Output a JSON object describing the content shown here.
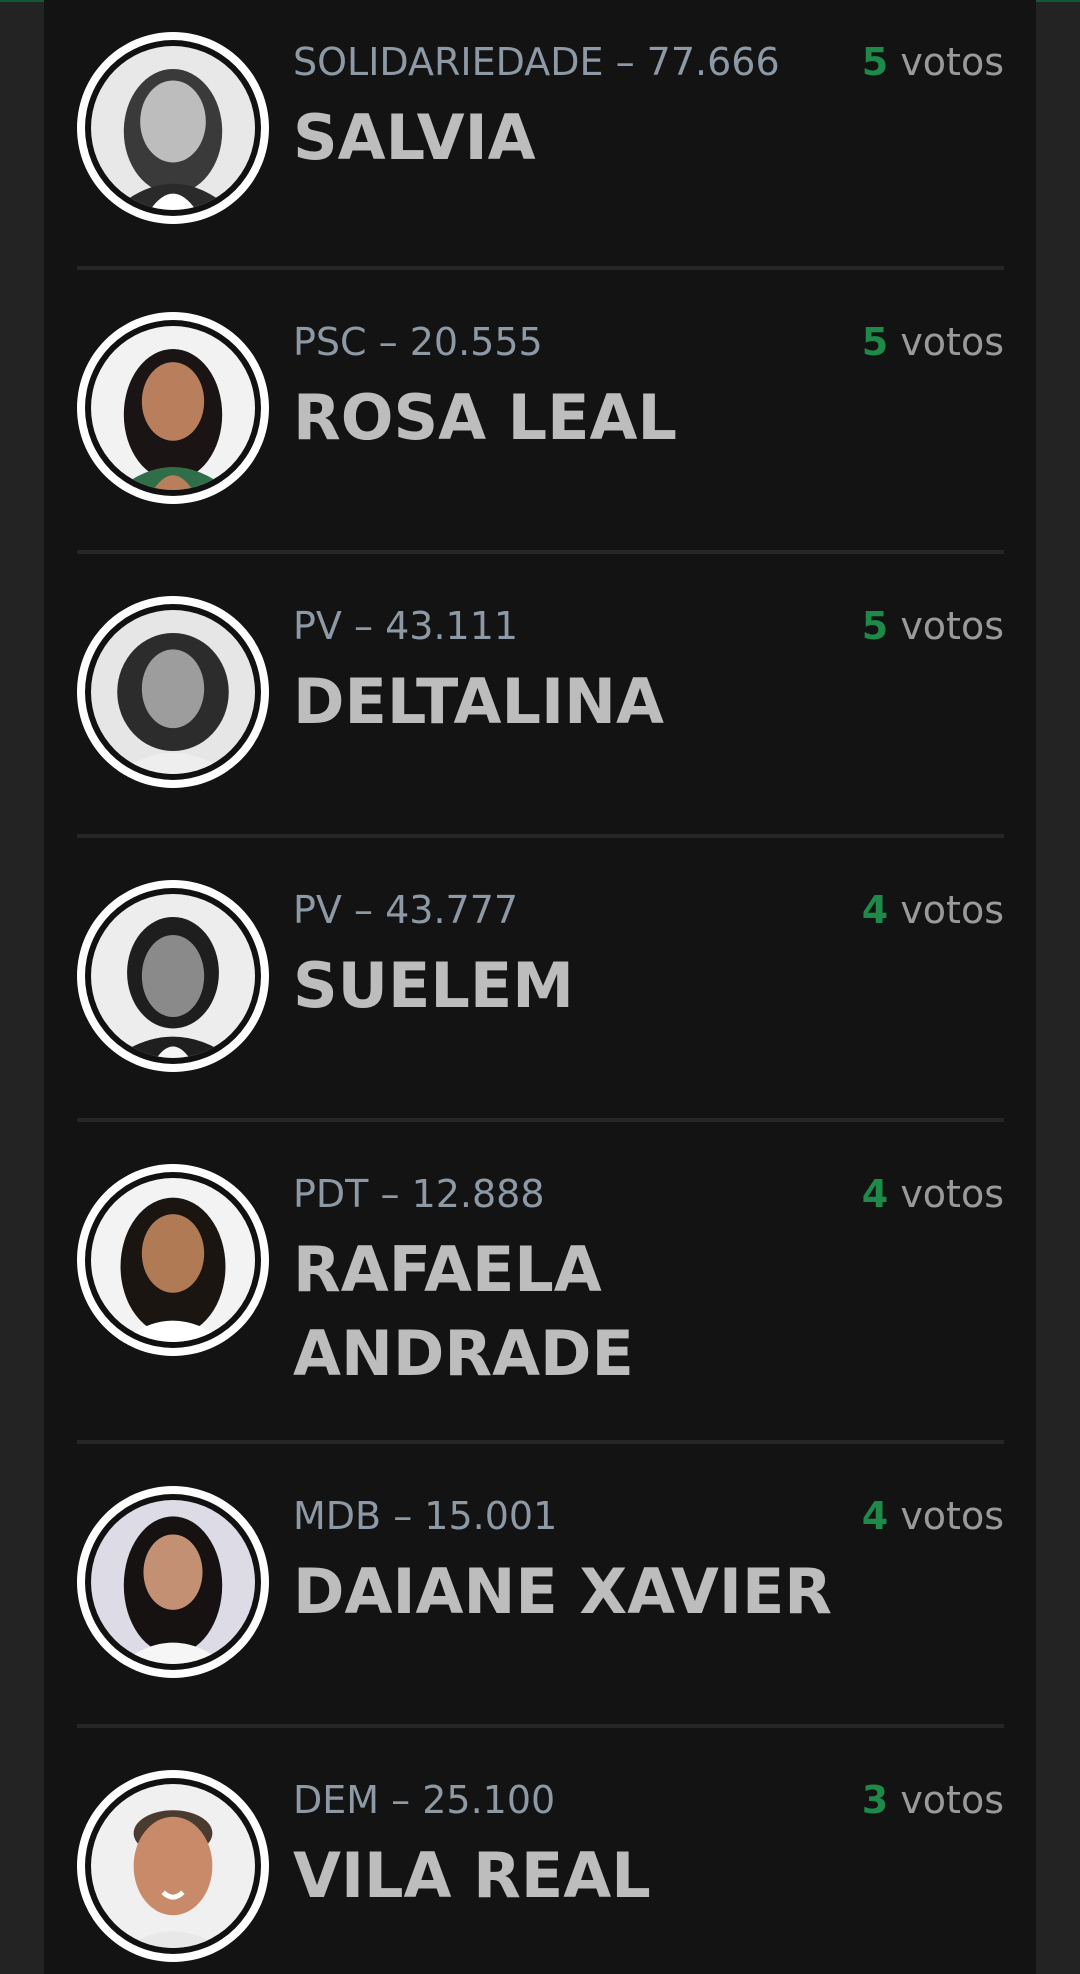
{
  "candidates": [
    {
      "party": "SOLIDARIEDADE",
      "number": "77.666",
      "name": "SALVIA",
      "votes": "5",
      "votes_label": "votos",
      "photo": "woman-portrait-grayscale"
    },
    {
      "party": "PSC",
      "number": "20.555",
      "name": "ROSA LEAL",
      "votes": "5",
      "votes_label": "votos",
      "photo": "woman-portrait-color"
    },
    {
      "party": "PV",
      "number": "43.111",
      "name": "DELTALINA",
      "votes": "5",
      "votes_label": "votos",
      "photo": "woman-portrait-grayscale"
    },
    {
      "party": "PV",
      "number": "43.777",
      "name": "SUELEM",
      "votes": "4",
      "votes_label": "votos",
      "photo": "woman-portrait-grayscale"
    },
    {
      "party": "PDT",
      "number": "12.888",
      "name": "RAFAELA ANDRADE",
      "votes": "4",
      "votes_label": "votos",
      "photo": "woman-portrait-color"
    },
    {
      "party": "MDB",
      "number": "15.001",
      "name": "DAIANE XAVIER",
      "votes": "4",
      "votes_label": "votos",
      "photo": "woman-portrait-color"
    },
    {
      "party": "DEM",
      "number": "25.100",
      "name": "VILA REAL",
      "votes": "3",
      "votes_label": "votos",
      "photo": "man-portrait-color"
    }
  ],
  "colors": {
    "background": "#232323",
    "panel": "#131313",
    "vote_count": "#1d8a4a",
    "meta_text": "#8d9aa6",
    "name_text": "#bdbdbd"
  }
}
